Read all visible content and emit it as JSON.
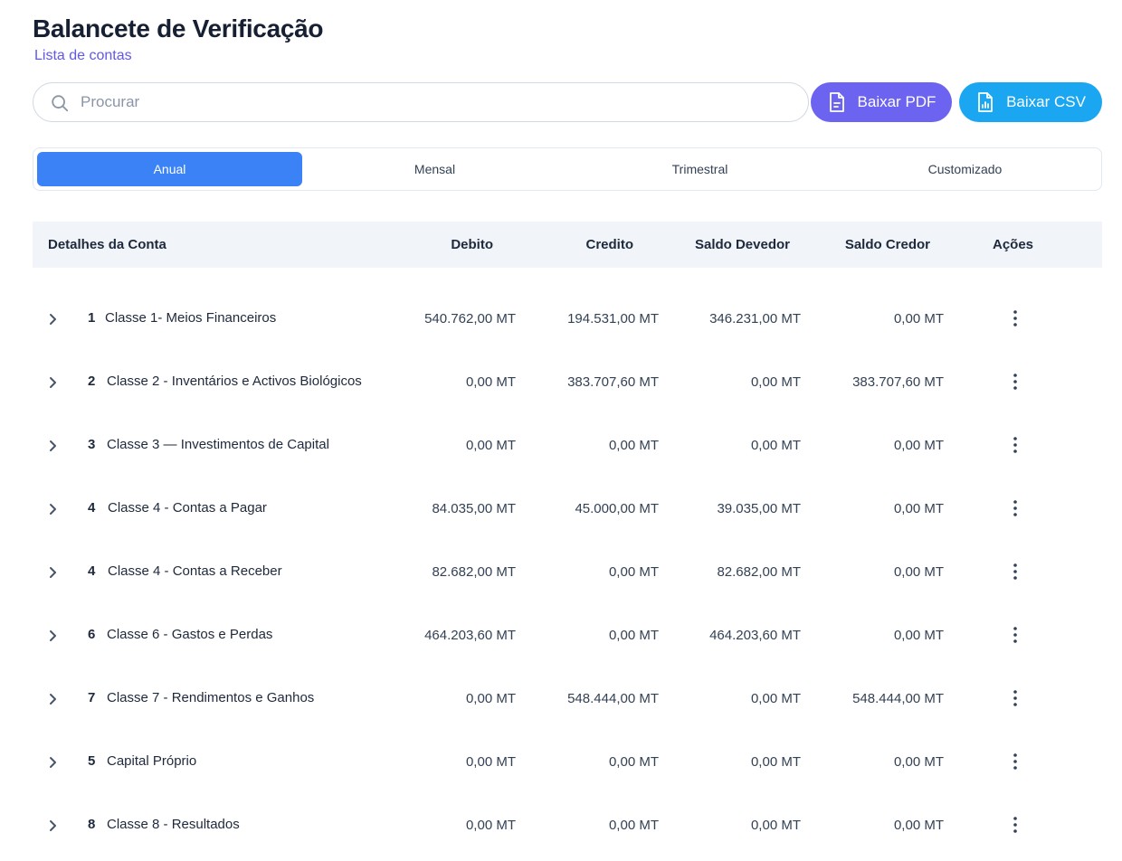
{
  "header": {
    "title": "Balancete de Verificação",
    "subtitle": "Lista de contas"
  },
  "search": {
    "placeholder": "Procurar",
    "value": ""
  },
  "buttons": {
    "pdf": "Baixar PDF",
    "csv": "Baixar CSV"
  },
  "tabs": [
    {
      "label": "Anual",
      "active": true
    },
    {
      "label": "Mensal",
      "active": false
    },
    {
      "label": "Trimestral",
      "active": false
    },
    {
      "label": "Customizado",
      "active": false
    }
  ],
  "table": {
    "headers": {
      "details": "Detalhes da Conta",
      "debit": "Debito",
      "credit": "Credito",
      "balance_debit": "Saldo Devedor",
      "balance_credit": "Saldo Credor",
      "actions": "Ações"
    },
    "rows": [
      {
        "num": "1",
        "name": "Classe 1- Meios Financeiros",
        "debit": "540.762,00 MT",
        "credit": "194.531,00 MT",
        "balance_debit": "346.231,00 MT",
        "balance_credit": "0,00 MT"
      },
      {
        "num": "2",
        "name": "Classe 2 - Inventários e Activos Biológicos",
        "debit": "0,00 MT",
        "credit": "383.707,60 MT",
        "balance_debit": "0,00 MT",
        "balance_credit": "383.707,60 MT"
      },
      {
        "num": "3",
        "name": "Classe 3 — Investimentos de Capital",
        "debit": "0,00 MT",
        "credit": "0,00 MT",
        "balance_debit": "0,00 MT",
        "balance_credit": "0,00 MT"
      },
      {
        "num": "4",
        "name": "Classe 4 - Contas a Pagar",
        "debit": "84.035,00 MT",
        "credit": "45.000,00 MT",
        "balance_debit": "39.035,00 MT",
        "balance_credit": "0,00 MT"
      },
      {
        "num": "4",
        "name": "Classe 4 - Contas a Receber",
        "debit": "82.682,00 MT",
        "credit": "0,00 MT",
        "balance_debit": "82.682,00 MT",
        "balance_credit": "0,00 MT"
      },
      {
        "num": "6",
        "name": "Classe 6 - Gastos e Perdas",
        "debit": "464.203,60 MT",
        "credit": "0,00 MT",
        "balance_debit": "464.203,60 MT",
        "balance_credit": "0,00 MT"
      },
      {
        "num": "7",
        "name": "Classe 7 - Rendimentos e Ganhos",
        "debit": "0,00 MT",
        "credit": "548.444,00 MT",
        "balance_debit": "0,00 MT",
        "balance_credit": "548.444,00 MT"
      },
      {
        "num": "5",
        "name": "Capital Próprio",
        "debit": "0,00 MT",
        "credit": "0,00 MT",
        "balance_debit": "0,00 MT",
        "balance_credit": "0,00 MT"
      },
      {
        "num": "8",
        "name": "Classe 8 - Resultados",
        "debit": "0,00 MT",
        "credit": "0,00 MT",
        "balance_debit": "0,00 MT",
        "balance_credit": "0,00 MT"
      }
    ]
  },
  "icons": {
    "search": "search-icon",
    "pdf": "file-text-icon",
    "csv": "file-chart-icon",
    "expand": "chevron-right-icon",
    "actions": "more-vertical-icon"
  },
  "colors": {
    "accent_pdf": "#6c63f0",
    "accent_csv": "#1aa6f0",
    "tab_active": "#3b82f6",
    "subtitle": "#6159e6",
    "header_bg": "#f1f5f9"
  }
}
